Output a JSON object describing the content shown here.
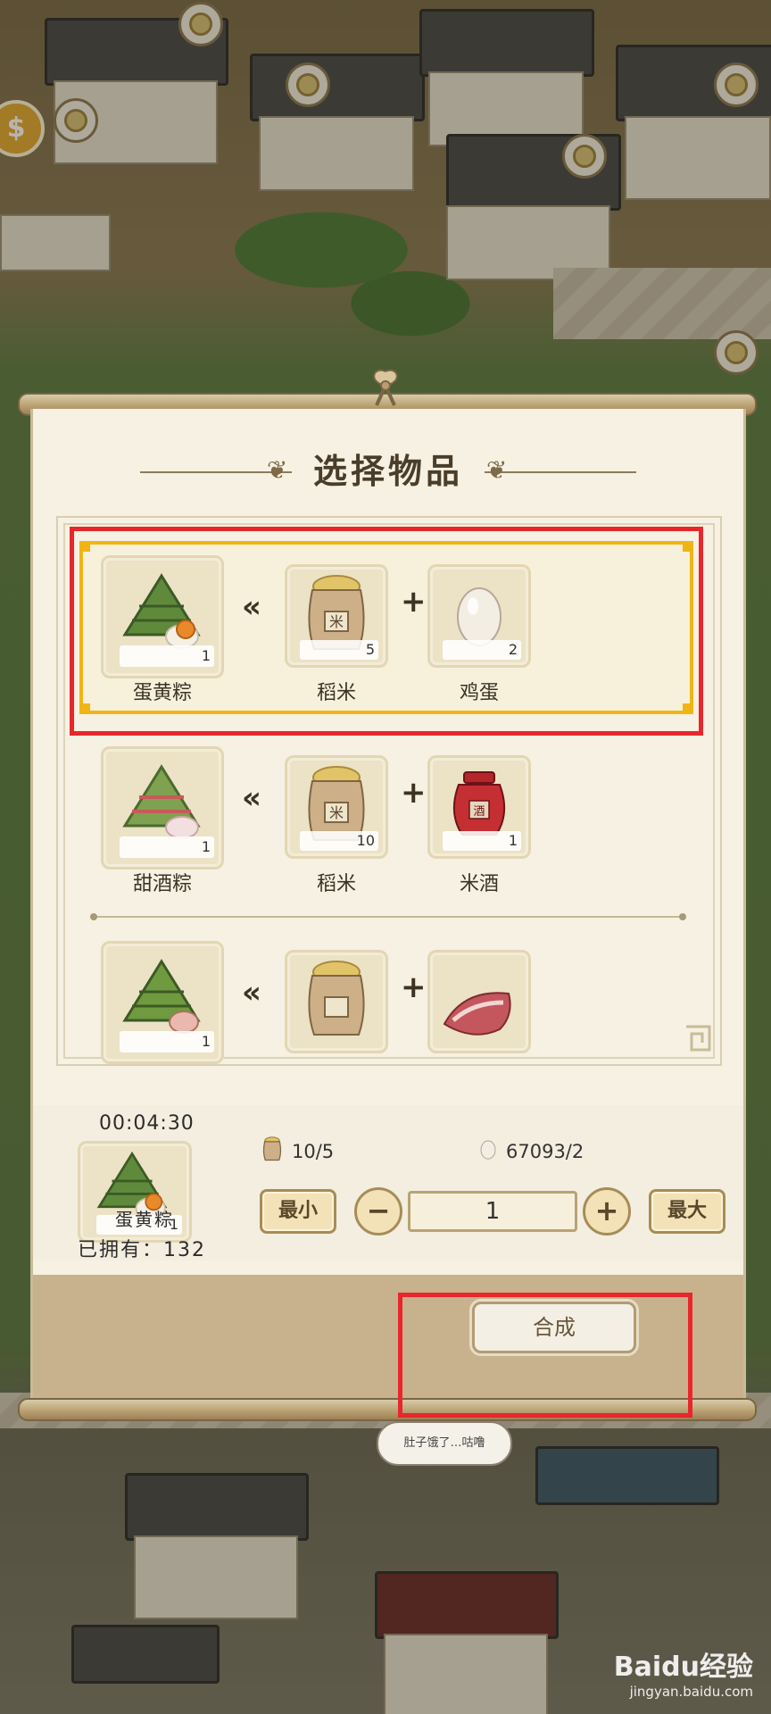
{
  "panel": {
    "title": "选择物品"
  },
  "recipes": [
    {
      "output": {
        "name": "蛋黄粽",
        "count": "1"
      },
      "inputs": [
        {
          "name": "稻米",
          "count": "5"
        },
        {
          "name": "鸡蛋",
          "count": "2"
        }
      ],
      "selected": true
    },
    {
      "output": {
        "name": "甜酒粽",
        "count": "1"
      },
      "inputs": [
        {
          "name": "稻米",
          "count": "10"
        },
        {
          "name": "米酒",
          "count": "1"
        }
      ],
      "selected": false
    },
    {
      "output": {
        "count": "1"
      },
      "inputs": [],
      "selected": false
    }
  ],
  "selected_item": {
    "timer": "00:04:30",
    "name": "蛋黄粽",
    "count": "1",
    "owned_label": "已拥有：",
    "owned_count": "132"
  },
  "requirements": {
    "rice": "10/5",
    "egg": "67093/2"
  },
  "controls": {
    "min_label": "最小",
    "max_label": "最大",
    "minus": "−",
    "plus": "+",
    "quantity": "1",
    "craft_label": "合成"
  },
  "speech_bubble": "肚子饿了…咕噜",
  "watermark": {
    "brand": "Baidu经验",
    "url": "jingyan.baidu.com"
  },
  "colors": {
    "highlight_gold": "#f0b515",
    "annotation_red": "#e8262b",
    "panel_bg": "#f6f1e2"
  },
  "icons": [
    "zongzi-egg-icon",
    "rice-sack-icon",
    "egg-icon",
    "zongzi-sweet-icon",
    "wine-jar-icon",
    "zongzi-meat-icon",
    "pork-icon",
    "coin-icon"
  ]
}
